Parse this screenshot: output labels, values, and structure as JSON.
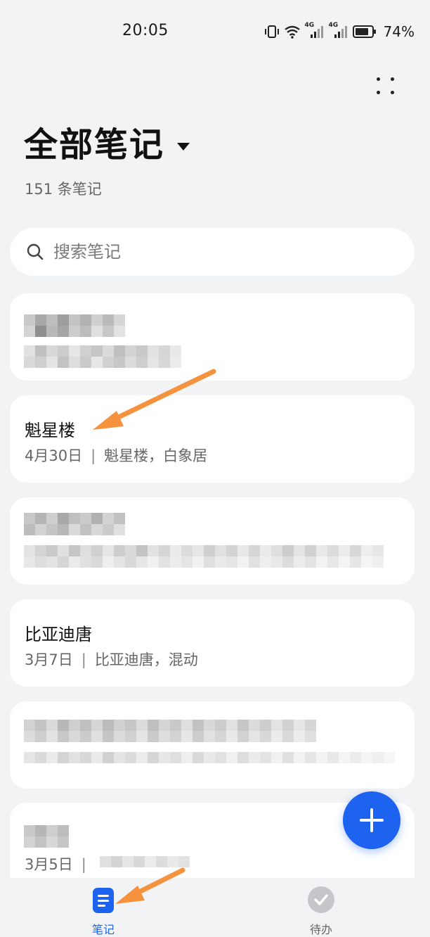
{
  "status_bar": {
    "time": "20:05",
    "network_1": "4G",
    "network_2": "4G",
    "battery": "74%"
  },
  "header": {
    "title": "全部笔记",
    "count_text": "151 条笔记"
  },
  "search": {
    "placeholder": "搜索笔记"
  },
  "notes": [
    {
      "title": "魁星楼",
      "date": "4月30日",
      "preview": "魁星楼，白象居"
    },
    {
      "title": "比亚迪唐",
      "date": "3月7日",
      "preview": "比亚迪唐，混动"
    },
    {
      "date": "3月5日"
    }
  ],
  "bottom_nav": {
    "tabs": [
      {
        "label": "笔记",
        "icon": "note-icon",
        "active": true
      },
      {
        "label": "待办",
        "icon": "check-circle-icon",
        "active": false
      }
    ]
  },
  "colors": {
    "accent": "#1d63f0",
    "background": "#f1f3f5",
    "card": "#ffffff",
    "annotation_arrow": "#f5923e"
  }
}
